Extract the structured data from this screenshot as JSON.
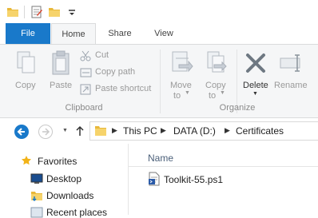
{
  "ribbon": {
    "tabs": [
      "File",
      "Home",
      "Share",
      "View"
    ],
    "clipboard": {
      "copy": "Copy",
      "paste": "Paste",
      "cut": "Cut",
      "copy_path": "Copy path",
      "paste_shortcut": "Paste shortcut",
      "group_label": "Clipboard"
    },
    "organize": {
      "move_to_line1": "Move",
      "move_to_line2": "to",
      "copy_to_line1": "Copy",
      "copy_to_line2": "to",
      "delete": "Delete",
      "rename": "Rename",
      "group_label": "Organize"
    }
  },
  "address": {
    "crumbs": [
      "This PC",
      "DATA (D:)",
      "Certificates"
    ]
  },
  "nav_pane": {
    "favorites": "Favorites",
    "items": [
      "Desktop",
      "Downloads",
      "Recent places"
    ]
  },
  "content": {
    "column_header": "Name",
    "files": [
      "Toolkit-55.ps1"
    ]
  },
  "colors": {
    "accent": "#1979ca",
    "ribbon_bg": "#f5f6f7",
    "disabled_text": "#9a9a9a"
  }
}
